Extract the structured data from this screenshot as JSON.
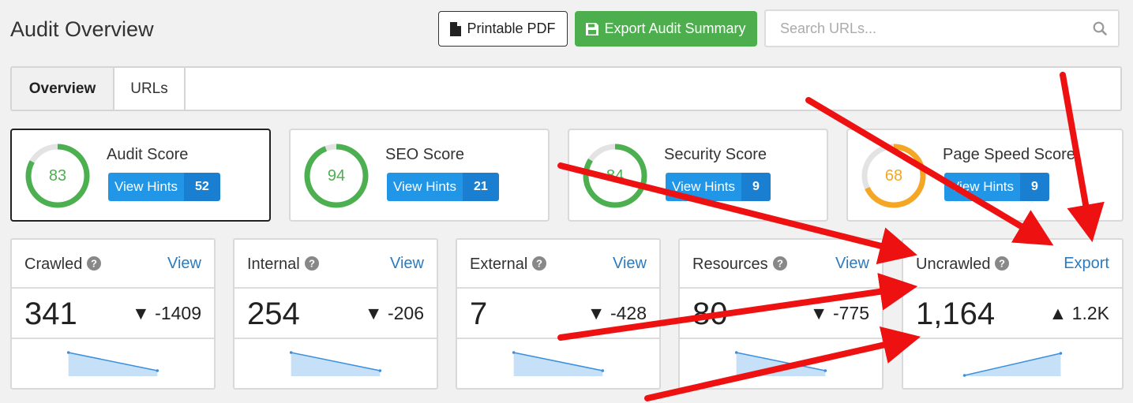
{
  "header": {
    "title": "Audit Overview",
    "pdf_label": "Printable PDF",
    "export_label": "Export Audit Summary",
    "search_placeholder": "Search URLs..."
  },
  "tabs": [
    {
      "label": "Overview",
      "active": true
    },
    {
      "label": "URLs",
      "active": false
    }
  ],
  "scores": [
    {
      "name": "Audit Score",
      "value": 83,
      "fraction": 0.83,
      "color": "#4caf50",
      "hints_label": "View Hints",
      "hints_count": "52"
    },
    {
      "name": "SEO Score",
      "value": 94,
      "fraction": 0.94,
      "color": "#4caf50",
      "hints_label": "View Hints",
      "hints_count": "21"
    },
    {
      "name": "Security Score",
      "value": 84,
      "fraction": 0.84,
      "color": "#4caf50",
      "hints_label": "View Hints",
      "hints_count": "9"
    },
    {
      "name": "Page Speed Score",
      "value": 68,
      "fraction": 0.68,
      "color": "#f5a623",
      "hints_label": "View Hints",
      "hints_count": "9"
    }
  ],
  "metrics": [
    {
      "name": "Crawled",
      "link": "View",
      "value": "341",
      "delta": "▼ -1409",
      "trend": "down"
    },
    {
      "name": "Internal",
      "link": "View",
      "value": "254",
      "delta": "▼ -206",
      "trend": "down"
    },
    {
      "name": "External",
      "link": "View",
      "value": "7",
      "delta": "▼ -428",
      "trend": "down"
    },
    {
      "name": "Resources",
      "link": "View",
      "value": "80",
      "delta": "▼ -775",
      "trend": "down"
    },
    {
      "name": "Uncrawled",
      "link": "Export",
      "value": "1,164",
      "delta": "▲ 1.2K",
      "trend": "up"
    }
  ],
  "colors": {
    "green_button": "#4cae4c",
    "hint_blue": "#2196e6",
    "link_blue": "#2b7bbf",
    "arrow_red": "#ee1111",
    "spark_line": "#3a8fde",
    "spark_fill": "#c6e0f7"
  }
}
